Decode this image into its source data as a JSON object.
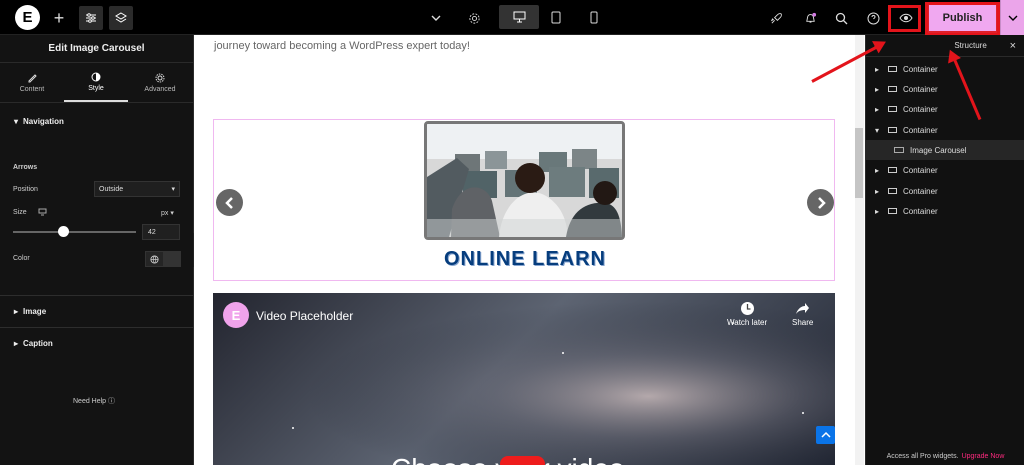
{
  "topbar": {
    "logo": "E",
    "add": "+",
    "publish_label": "Publish"
  },
  "left_panel": {
    "title": "Edit Image Carousel",
    "tabs": [
      "Content",
      "Style",
      "Advanced"
    ],
    "navigation_section": "Navigation",
    "arrows_label": "Arrows",
    "position_label": "Position",
    "position_value": "Outside",
    "size_label": "Size",
    "size_unit": "px",
    "size_value": "42",
    "size_slider_fraction": 0.42,
    "color_label": "Color",
    "image_section": "Image",
    "caption_section": "Caption",
    "need_help": "Need Help"
  },
  "canvas": {
    "intro_text": "journey toward becoming a WordPress expert today!",
    "carousel_caption": "ONLINE LEARN",
    "video_title": "Video Placeholder",
    "watch_later": "Watch later",
    "share": "Share",
    "choose_text": "Choose your video"
  },
  "structure_panel": {
    "title": "Structure",
    "items": [
      "Container",
      "Container",
      "Container",
      "Container",
      "Image Carousel",
      "Container",
      "Container",
      "Container"
    ],
    "footer_text": "Access all Pro widgets.",
    "upgrade_text": "Upgrade Now"
  },
  "colors": {
    "publish_bg": "#f0a8f0",
    "annotation": "#e3141b",
    "caption": "#063d7d"
  }
}
